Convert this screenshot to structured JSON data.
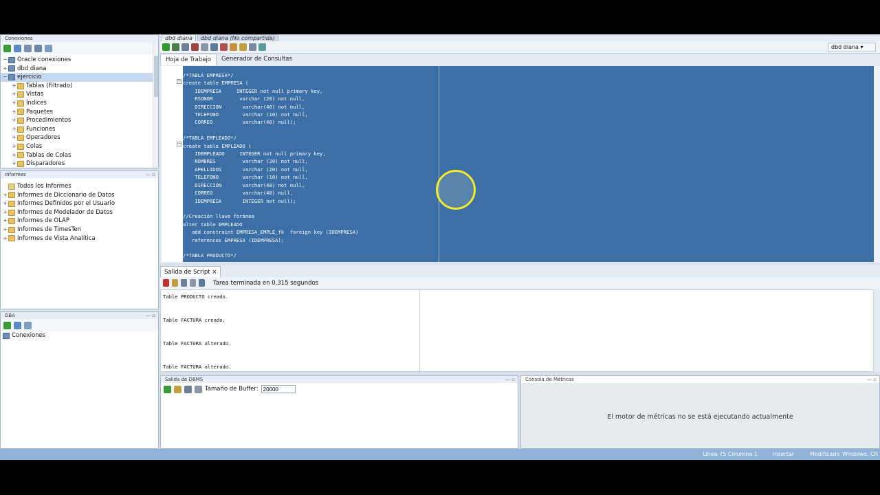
{
  "left": {
    "connections_title": "Conexiones",
    "tree": [
      {
        "label": "Oracle conexiones",
        "level": 0,
        "expander": "−",
        "icon": "db"
      },
      {
        "label": "dbd diana",
        "level": 0,
        "expander": "+",
        "icon": "db"
      },
      {
        "label": "ejercicio",
        "level": 0,
        "expander": "−",
        "icon": "db",
        "selected": true
      },
      {
        "label": "Tablas (Filtrado)",
        "level": 1,
        "expander": "+",
        "icon": "folder"
      },
      {
        "label": "Vistas",
        "level": 1,
        "expander": "+",
        "icon": "folder"
      },
      {
        "label": "Índices",
        "level": 1,
        "expander": "+",
        "icon": "folder"
      },
      {
        "label": "Paquetes",
        "level": 1,
        "expander": "+",
        "icon": "folder"
      },
      {
        "label": "Procedimientos",
        "level": 1,
        "expander": "+",
        "icon": "folder"
      },
      {
        "label": "Funciones",
        "level": 1,
        "expander": "+",
        "icon": "folder"
      },
      {
        "label": "Operadores",
        "level": 1,
        "expander": "+",
        "icon": "folder"
      },
      {
        "label": "Colas",
        "level": 1,
        "expander": "+",
        "icon": "folder"
      },
      {
        "label": "Tablas de Colas",
        "level": 1,
        "expander": "+",
        "icon": "folder"
      },
      {
        "label": "Disparadores",
        "level": 1,
        "expander": "+",
        "icon": "folder"
      }
    ],
    "reports_title": "Informes",
    "reports": [
      {
        "label": "Todos los Informes",
        "level": 0,
        "expander": "",
        "icon": "report"
      },
      {
        "label": "Informes de Diccionario de Datos",
        "level": 0,
        "expander": "+",
        "icon": "folder"
      },
      {
        "label": "Informes Definidos por el Usuario",
        "level": 0,
        "expander": "+",
        "icon": "folder"
      },
      {
        "label": "Informes de Modelador de Datos",
        "level": 0,
        "expander": "+",
        "icon": "folder"
      },
      {
        "label": "Informes de OLAP",
        "level": 0,
        "expander": "+",
        "icon": "folder"
      },
      {
        "label": "Informes de TimesTen",
        "level": 0,
        "expander": "+",
        "icon": "folder"
      },
      {
        "label": "Informes de Vista Analítica",
        "level": 0,
        "expander": "+",
        "icon": "folder"
      }
    ],
    "dba_title": "DBA",
    "dba_item": "Conexiones"
  },
  "editor": {
    "tabs": [
      "dbd diana",
      "dbd diana (No compartida)"
    ],
    "connection": "dbd diana",
    "subtabs": [
      "Hoja de Trabajo",
      "Generador de Consultas"
    ],
    "code": [
      "/*TABLA EMPRESA*/",
      "create table EMPRESA (",
      "    IDEMPRESA     INTEGER not null primary key,",
      "    RSONOM         varchar (20) not null,",
      "    DIRECCION       varchar(40) not null,",
      "    TELEFONO        varchar (10) not null,",
      "    CORREO          varchar(40) null);",
      "",
      "/*TABLA EMPLEADO*/",
      "create table EMPLEADO (",
      "    IDEMPLEADO     INTEGER not null primary key,",
      "    NOMBRES         varchar (20) not null,",
      "    APELLIDOS       varchar (20) not null,",
      "    TELEFONO        varchar (10) not null,",
      "    DIRECCION       varchar(40) not null,",
      "    CORREO          varchar(40) null,",
      "    IDEMPRESA       INTEGER not null);",
      "",
      "//Creación llave foránea",
      "alter table EMPLEADO",
      "   add constraint EMPRESA_EMPLE_fk  foreign key (IDEMPRESA)",
      "   references EMPRESA (IDEMPRESA);",
      "",
      "/*TABLA PRODUCTO*/"
    ]
  },
  "script_output": {
    "tab": "Salida de Script",
    "status": "Tarea terminada en 0,315 segundos",
    "lines": [
      "Table PRODUCTO creado.",
      "",
      "",
      "Table FACTURA creado.",
      "",
      "",
      "Table FACTURA alterado.",
      "",
      "",
      "Table FACTURA alterado."
    ]
  },
  "dbms": {
    "title": "Salida de DBMS",
    "buffer_label": "Tamaño de Buffer:",
    "buffer_value": "20000"
  },
  "metrics": {
    "title": "Consola de Métricas",
    "message": "El motor de métricas no se está ejecutando actualmente"
  },
  "status": {
    "position": "Línea 75 Columna 1",
    "mode": "Insertar",
    "modified": "Modificado",
    "eol": "Windows: CR"
  }
}
